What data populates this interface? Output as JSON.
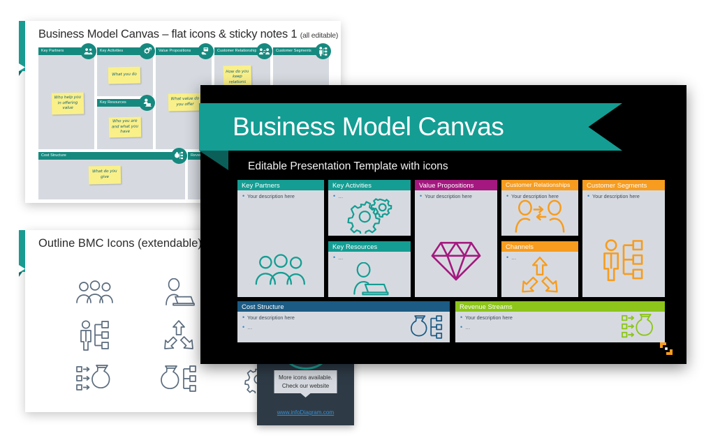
{
  "colors": {
    "teal": "#149d93",
    "teal_dark": "#0c6f68",
    "magenta": "#a4187f",
    "orange": "#f79c1e",
    "navy": "#1c5b84",
    "green": "#8dc51a",
    "slate": "#2e3b47",
    "sticky_yellow": "#faf08a",
    "card_gray": "#d6dae0",
    "link_blue": "#3a8fd0"
  },
  "slide_flat": {
    "title": "Business Model Canvas – flat icons & sticky notes 1",
    "title_suffix": "(all editable)",
    "boxes": [
      {
        "label": "Key Partners",
        "icon": "group-people-icon"
      },
      {
        "label": "Key Activities",
        "icon": "gears-icon"
      },
      {
        "label": "Key Resources",
        "icon": "person-laptop-icon"
      },
      {
        "label": "Value Propositions",
        "icon": "hand-gift-icon"
      },
      {
        "label": "Customer Relationship",
        "icon": "two-people-arrows-icon"
      },
      {
        "label": "Customer Segments",
        "icon": "person-org-icon"
      },
      {
        "label": "Cost Structure",
        "icon": "money-bag-org-icon"
      },
      {
        "label": "Revenue Streams",
        "icon": "money-flow-icon"
      }
    ],
    "sticky_notes": [
      "Who help you in offering value",
      "What you do",
      "Who you are and what you have",
      "What value do you offer",
      "How do you keep relations with your",
      "What do you give"
    ]
  },
  "slide_outline": {
    "title": "Outline BMC Icons (extendable)",
    "icons": [
      "group-people-icon",
      "person-laptop-icon",
      "diamond-icon",
      "person-org-icon",
      "three-arrows-icon",
      "two-people-arrows-icon",
      "money-flow-icon",
      "money-bag-org-icon",
      "gears-icon"
    ]
  },
  "panel": {
    "tooltip_line1": "More icons available.",
    "tooltip_line2": "Check our website",
    "link": "www.infoDiagram.com"
  },
  "dark_slide": {
    "title": "Business Model Canvas",
    "subtitle": "Editable Presentation Template with icons",
    "logo": "infodiagram-bracket-logo",
    "bullet_primary": "Your description here",
    "bullet_secondary": "…",
    "cards": [
      {
        "label": "Key Partners",
        "icon": "group-people-icon",
        "color": "#149d93",
        "fold": "#0c6f68",
        "bullets": [
          "Your description here"
        ]
      },
      {
        "label": "Key Activities",
        "icon": "gears-icon",
        "color": "#149d93",
        "fold": "#0c6f68",
        "bullets": [
          "…"
        ]
      },
      {
        "label": "Key Resources",
        "icon": "person-laptop-icon",
        "color": "#149d93",
        "fold": "#0c6f68",
        "bullets": [
          "…"
        ]
      },
      {
        "label": "Value Propositions",
        "icon": "diamond-icon",
        "color": "#a4187f",
        "fold": "#74125a",
        "bullets": [
          "Your description here"
        ]
      },
      {
        "label": "Customer Relationships",
        "icon": "two-people-arrows-icon",
        "color": "#f79c1e",
        "fold": "#c87a10",
        "bullets": [
          "Your description here"
        ]
      },
      {
        "label": "Channels",
        "icon": "three-arrows-icon",
        "color": "#f79c1e",
        "fold": "#c87a10",
        "bullets": [
          "…"
        ]
      },
      {
        "label": "Customer Segments",
        "icon": "person-org-icon",
        "color": "#f79c1e",
        "fold": "#c87a10",
        "bullets": [
          "Your description here"
        ]
      },
      {
        "label": "Cost Structure",
        "icon": "money-bag-org-icon",
        "color": "#1c5b84",
        "fold": "#123f5c",
        "bullets": [
          "Your description here",
          "…"
        ]
      },
      {
        "label": "Revenue Streams",
        "icon": "money-flow-icon",
        "color": "#8dc51a",
        "fold": "#669114",
        "bullets": [
          "Your description here",
          "…"
        ]
      }
    ]
  }
}
